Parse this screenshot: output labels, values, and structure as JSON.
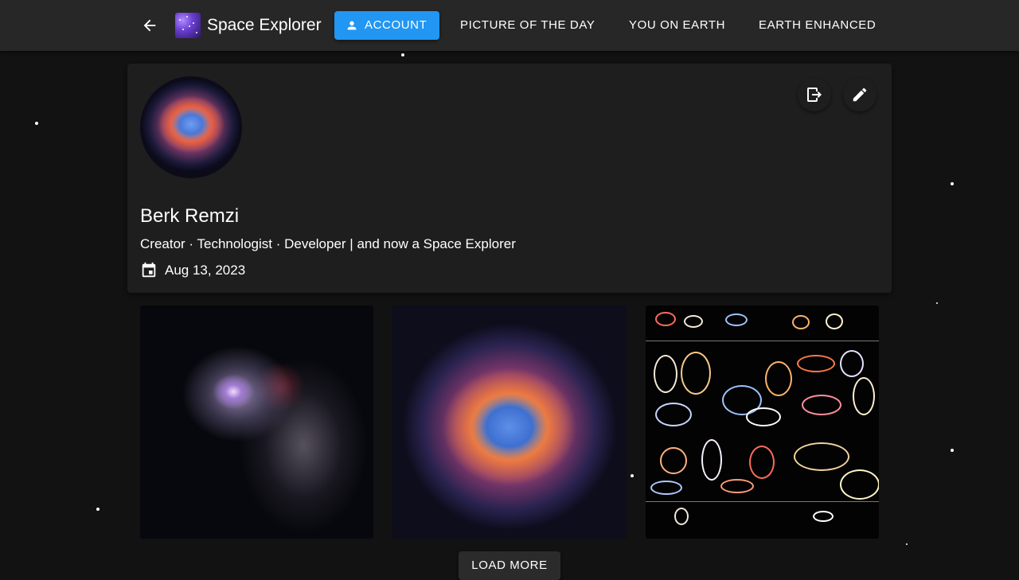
{
  "app": {
    "title": "Space Explorer",
    "back_icon": "arrow-back-icon",
    "logo_icon": "galaxy-logo"
  },
  "nav": {
    "items": [
      {
        "label": "ACCOUNT",
        "icon": "person-icon",
        "active": true
      },
      {
        "label": "PICTURE OF THE DAY",
        "active": false
      },
      {
        "label": "YOU ON EARTH",
        "active": false
      },
      {
        "label": "EARTH ENHANCED",
        "active": false
      }
    ]
  },
  "profile": {
    "name": "Berk Remzi",
    "bio": "Creator · Technologist · Developer | and now a Space Explorer",
    "date": "Aug 13, 2023",
    "date_icon": "calendar-icon",
    "actions": {
      "logout_icon": "logout-icon",
      "edit_icon": "edit-pencil-icon"
    }
  },
  "gallery": {
    "images": [
      "spiral-galaxy-image",
      "ring-nebula-image",
      "star-trails-chart-image"
    ]
  },
  "load_more_label": "LOAD MORE",
  "colors": {
    "background": "#121212",
    "appbar": "#272727",
    "card": "#1e1e1e",
    "accent": "#2196f3"
  }
}
